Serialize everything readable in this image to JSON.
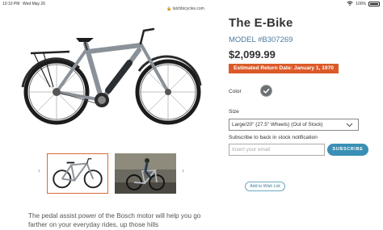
{
  "status_bar": {
    "time": "10:10 PM",
    "date": "Wed May 26",
    "url": "lutchbicycles.com",
    "battery": "100%"
  },
  "product": {
    "title": "The E-Bike",
    "model": "MODEL #B307269",
    "price": "$2,099.99",
    "return_date": "Estimated Return Date: January 1, 1970",
    "color_label": "Color",
    "size_label": "Size",
    "size_selected": "Large/20\" (27.5\" Wheels) (Out of Stock)",
    "subscribe_label": "Subscribe to back in stock notification",
    "email_placeholder": "Insert your email",
    "subscribe_button": "SUBSCRIBE",
    "wishlist_button": "Add to Wish List",
    "description": "The pedal assist power of the Bosch motor will help you go farther on your everyday rides, up those hills"
  },
  "gallery": {
    "prev_arrow": "‹",
    "next_arrow": "›"
  },
  "colors": {
    "accent_orange": "#db5a27",
    "model_blue": "#4a7aa0",
    "subscribe_blue": "#3a8fb4",
    "bike_frame": "#8a9198"
  }
}
